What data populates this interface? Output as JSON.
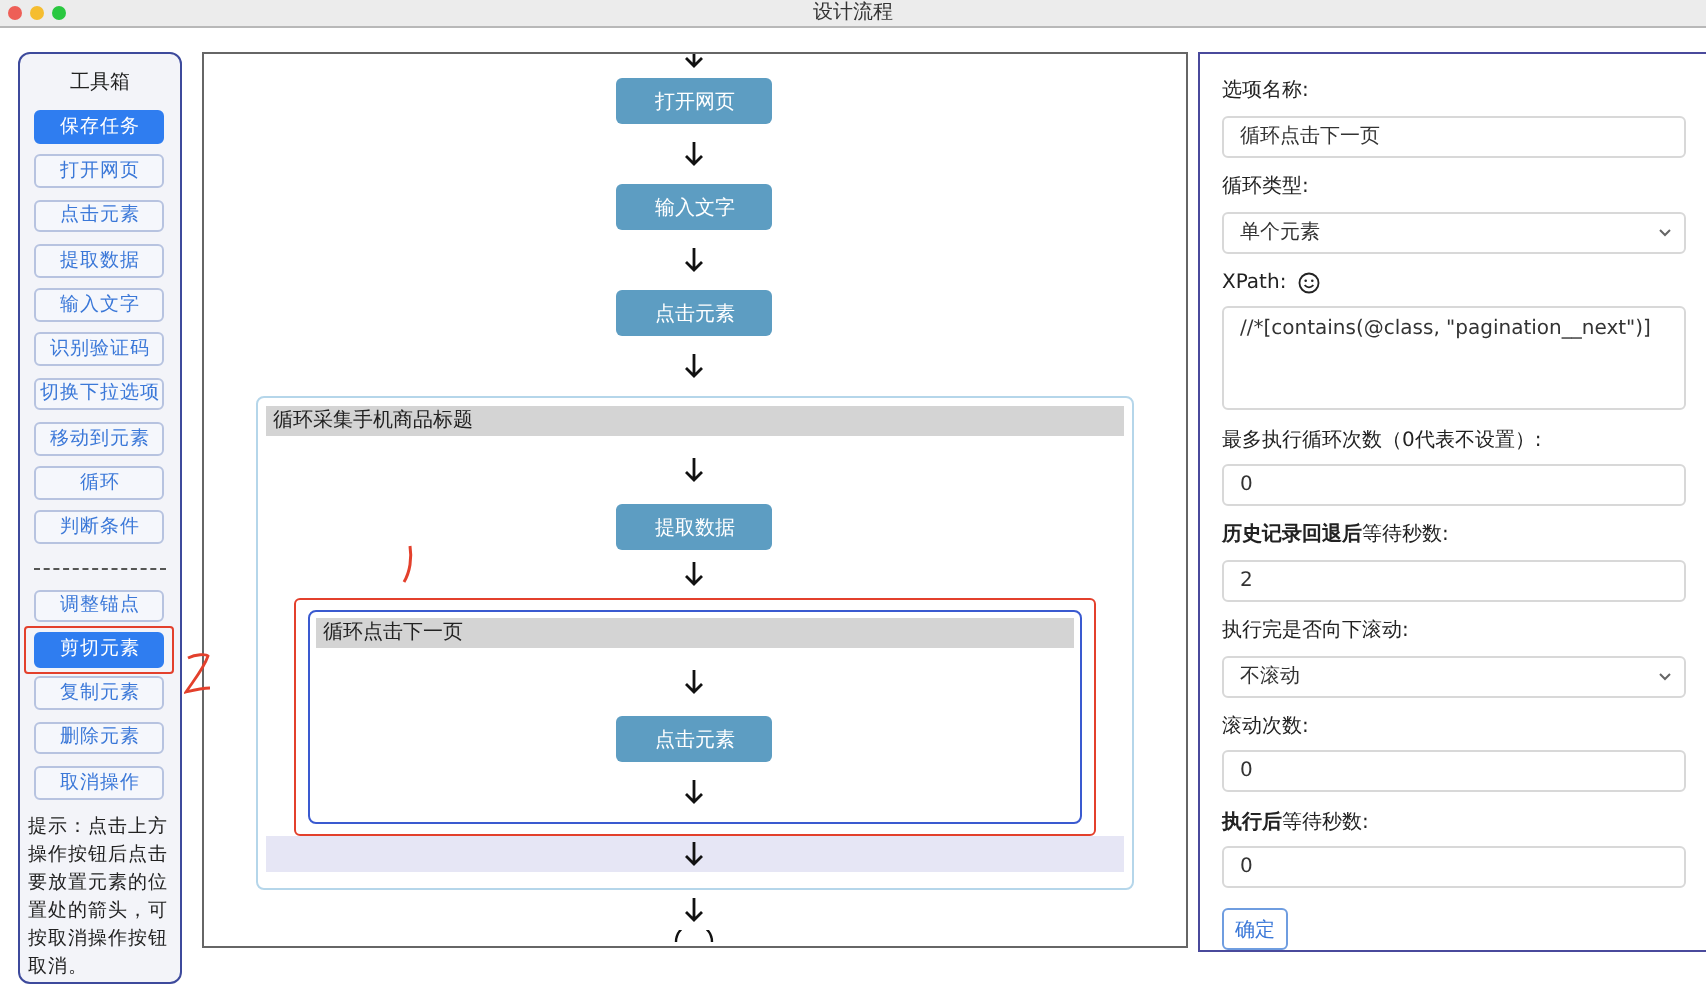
{
  "window": {
    "title": "设计流程"
  },
  "toolbox": {
    "title": "工具箱",
    "save_button": "保存任务",
    "tools": [
      {
        "label": "打开网页",
        "selected": false
      },
      {
        "label": "点击元素",
        "selected": false
      },
      {
        "label": "提取数据",
        "selected": false
      },
      {
        "label": "输入文字",
        "selected": false
      },
      {
        "label": "识别验证码",
        "selected": false
      },
      {
        "label": "切换下拉选项",
        "selected": false
      },
      {
        "label": "移动到元素",
        "selected": false
      },
      {
        "label": "循环",
        "selected": false
      },
      {
        "label": "判断条件",
        "selected": false
      }
    ],
    "edit_tools": [
      {
        "label": "调整锚点",
        "selected": false,
        "annotated": false
      },
      {
        "label": "剪切元素",
        "selected": true,
        "annotated": true
      },
      {
        "label": "复制元素",
        "selected": false,
        "annotated": false
      },
      {
        "label": "删除元素",
        "selected": false,
        "annotated": false
      },
      {
        "label": "取消操作",
        "selected": false,
        "annotated": false
      }
    ],
    "hint": "提示：点击上方操作按钮后点击要放置元素的位置处的箭头，可按取消操作按钮取消。"
  },
  "flow": {
    "items": [
      {
        "kind": "node",
        "label": "打开网页"
      },
      {
        "kind": "node",
        "label": "输入文字"
      },
      {
        "kind": "node",
        "label": "点击元素"
      },
      {
        "kind": "loop",
        "title": "循环采集手机商品标题",
        "selected": false,
        "annotated": false,
        "end_highlighted": true,
        "children": [
          {
            "kind": "node",
            "label": "提取数据"
          },
          {
            "kind": "loop",
            "title": "循环点击下一页",
            "selected": true,
            "annotated": true,
            "end_highlighted": false,
            "children": [
              {
                "kind": "node",
                "label": "点击元素"
              }
            ]
          }
        ]
      }
    ]
  },
  "options": {
    "fields": [
      {
        "kind": "text",
        "label": "选项名称:",
        "value": "循环点击下一页"
      },
      {
        "kind": "select",
        "label": "循环类型:",
        "value": "单个元素"
      },
      {
        "kind": "textarea",
        "label": "XPath:",
        "help_icon": true,
        "value": "//*[contains(@class, \"pagination__next\")]"
      },
      {
        "kind": "text",
        "label": "最多执行循环次数（0代表不设置）:",
        "value": "0"
      },
      {
        "kind": "text",
        "label": "**历史记录回退后**等待秒数:",
        "value": "2"
      },
      {
        "kind": "select",
        "label": "执行完是否向下滚动:",
        "value": "不滚动"
      },
      {
        "kind": "text",
        "label": "滚动次数:",
        "value": "0"
      },
      {
        "kind": "text",
        "label": "**执行后**等待秒数:",
        "value": "0"
      }
    ],
    "confirm_button": "确定"
  }
}
